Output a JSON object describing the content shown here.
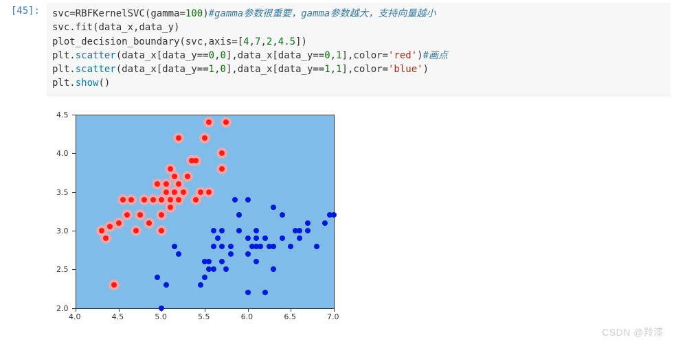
{
  "cell": {
    "prompt": "[45]:",
    "code": {
      "l1": {
        "pre": "svc",
        "eq": "=",
        "fn": "RBFKernelSVC",
        "open": "(gamma",
        "eq2": "=",
        "val": "100",
        "close": ")",
        "comment": "#gamma参数很重要，gamma参数越大，支持向量越小"
      },
      "l2": {
        "pre": "svc",
        "dot": ".",
        "call": "fit",
        "args": "(data_x,data_y)"
      },
      "l3": {
        "pre": "plot_decision_boundary(svc,axis",
        "eq": "=",
        "arr": "[",
        "v1": "4",
        "c1": ",",
        "v2": "7",
        "c2": ",",
        "v3": "2",
        "c3": ",",
        "v4": "4.5",
        "arr2": "])"
      },
      "l4": {
        "pre": "plt",
        "dot": ".",
        "call": "scatter",
        "args1": "(data_x[data_y",
        "eq1": "==",
        "n1": "0",
        "mid1": ",",
        "n2": "0",
        "mid2": "],data_x[data_y",
        "eq2": "==",
        "n3": "0",
        "mid3": ",",
        "n4": "1",
        "mid4": "],color",
        "eq3": "=",
        "str": "'red'",
        "end": ")",
        "comment": "#画点"
      },
      "l5": {
        "pre": "plt",
        "dot": ".",
        "call": "scatter",
        "args1": "(data_x[data_y",
        "eq1": "==",
        "n1": "1",
        "mid1": ",",
        "n2": "0",
        "mid2": "],data_x[data_y",
        "eq2": "==",
        "n3": "1",
        "mid3": ",",
        "n4": "1",
        "mid4": "],color",
        "eq3": "=",
        "str": "'blue'",
        "end": ")"
      },
      "l6": {
        "pre": "plt",
        "dot": ".",
        "call": "show",
        "args": "()"
      }
    }
  },
  "watermark": "CSDN @羚漆",
  "chart_data": {
    "type": "scatter",
    "xlabel": "",
    "ylabel": "",
    "xlim": [
      4.0,
      7.0
    ],
    "ylim": [
      2.0,
      4.5
    ],
    "xticks": [
      "4.0",
      "4.5",
      "5.0",
      "5.5",
      "6.0",
      "6.5",
      "7.0"
    ],
    "yticks": [
      "2.0",
      "2.5",
      "3.0",
      "3.5",
      "4.0",
      "4.5"
    ],
    "background_region": "full area light blue (class 1), with pink halos around each red point (gamma=100 overfit islands)",
    "series": [
      {
        "name": "class 0 (red)",
        "color": "#ff1a1a",
        "points": [
          [
            4.3,
            3.0
          ],
          [
            4.35,
            2.9
          ],
          [
            4.4,
            3.05
          ],
          [
            4.45,
            2.3
          ],
          [
            4.5,
            3.1
          ],
          [
            4.55,
            3.4
          ],
          [
            4.6,
            3.2
          ],
          [
            4.65,
            3.4
          ],
          [
            4.7,
            3.0
          ],
          [
            4.75,
            3.2
          ],
          [
            4.8,
            3.4
          ],
          [
            4.85,
            3.1
          ],
          [
            4.9,
            3.4
          ],
          [
            4.95,
            3.6
          ],
          [
            5.0,
            3.0
          ],
          [
            5.0,
            3.2
          ],
          [
            5.0,
            3.4
          ],
          [
            5.05,
            3.5
          ],
          [
            5.05,
            3.6
          ],
          [
            5.1,
            3.3
          ],
          [
            5.1,
            3.8
          ],
          [
            5.1,
            3.4
          ],
          [
            5.15,
            3.5
          ],
          [
            5.15,
            3.7
          ],
          [
            5.2,
            3.4
          ],
          [
            5.2,
            3.6
          ],
          [
            5.2,
            4.2
          ],
          [
            5.25,
            3.5
          ],
          [
            5.3,
            3.7
          ],
          [
            5.35,
            3.9
          ],
          [
            5.4,
            3.4
          ],
          [
            5.4,
            3.9
          ],
          [
            5.45,
            3.5
          ],
          [
            5.5,
            4.2
          ],
          [
            5.55,
            3.5
          ],
          [
            5.55,
            4.4
          ],
          [
            5.7,
            3.8
          ],
          [
            5.7,
            4.0
          ],
          [
            5.75,
            4.4
          ]
        ]
      },
      {
        "name": "class 1 (blue)",
        "color": "#0018d8",
        "points": [
          [
            4.95,
            2.4
          ],
          [
            5.0,
            2.0
          ],
          [
            5.05,
            2.3
          ],
          [
            5.15,
            2.8
          ],
          [
            5.2,
            2.7
          ],
          [
            5.45,
            2.3
          ],
          [
            5.5,
            2.4
          ],
          [
            5.5,
            2.6
          ],
          [
            5.55,
            2.5
          ],
          [
            5.55,
            2.6
          ],
          [
            5.6,
            2.5
          ],
          [
            5.6,
            2.8
          ],
          [
            5.6,
            3.0
          ],
          [
            5.65,
            2.9
          ],
          [
            5.7,
            2.6
          ],
          [
            5.7,
            2.8
          ],
          [
            5.7,
            3.0
          ],
          [
            5.75,
            2.5
          ],
          [
            5.8,
            2.7
          ],
          [
            5.8,
            2.8
          ],
          [
            5.85,
            3.4
          ],
          [
            5.9,
            3.0
          ],
          [
            5.9,
            3.2
          ],
          [
            6.0,
            2.2
          ],
          [
            6.0,
            2.7
          ],
          [
            6.0,
            2.9
          ],
          [
            6.0,
            3.4
          ],
          [
            6.05,
            2.8
          ],
          [
            6.1,
            2.6
          ],
          [
            6.1,
            2.8
          ],
          [
            6.1,
            2.9
          ],
          [
            6.1,
            3.0
          ],
          [
            6.15,
            2.8
          ],
          [
            6.2,
            2.2
          ],
          [
            6.2,
            2.9
          ],
          [
            6.25,
            2.8
          ],
          [
            6.3,
            2.5
          ],
          [
            6.3,
            2.8
          ],
          [
            6.3,
            3.3
          ],
          [
            6.4,
            2.9
          ],
          [
            6.4,
            3.2
          ],
          [
            6.5,
            2.8
          ],
          [
            6.55,
            3.0
          ],
          [
            6.6,
            2.9
          ],
          [
            6.6,
            3.0
          ],
          [
            6.7,
            3.0
          ],
          [
            6.7,
            3.1
          ],
          [
            6.8,
            2.8
          ],
          [
            6.9,
            3.1
          ],
          [
            6.95,
            3.2
          ],
          [
            7.0,
            3.2
          ]
        ]
      }
    ]
  }
}
